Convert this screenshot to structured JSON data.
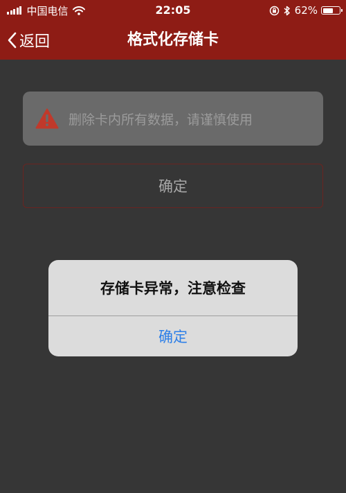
{
  "status_bar": {
    "carrier": "中国电信",
    "time": "22:05",
    "battery": "62%",
    "battery_level": 0.62,
    "icons": [
      "signal-icon",
      "wifi-icon",
      "orientation-lock-icon",
      "bluetooth-icon",
      "battery-icon"
    ]
  },
  "nav": {
    "back_label": "返回",
    "title": "格式化存储卡"
  },
  "content": {
    "warning_text": "删除卡内所有数据，请谨慎使用",
    "confirm_label": "确定"
  },
  "alert": {
    "message": "存储卡异常，注意检查",
    "button_label": "确定"
  },
  "colors": {
    "header": "#8e1c15",
    "background": "#363636",
    "warning_icon": "#c0392b",
    "alert_button": "#2d7fe8"
  }
}
